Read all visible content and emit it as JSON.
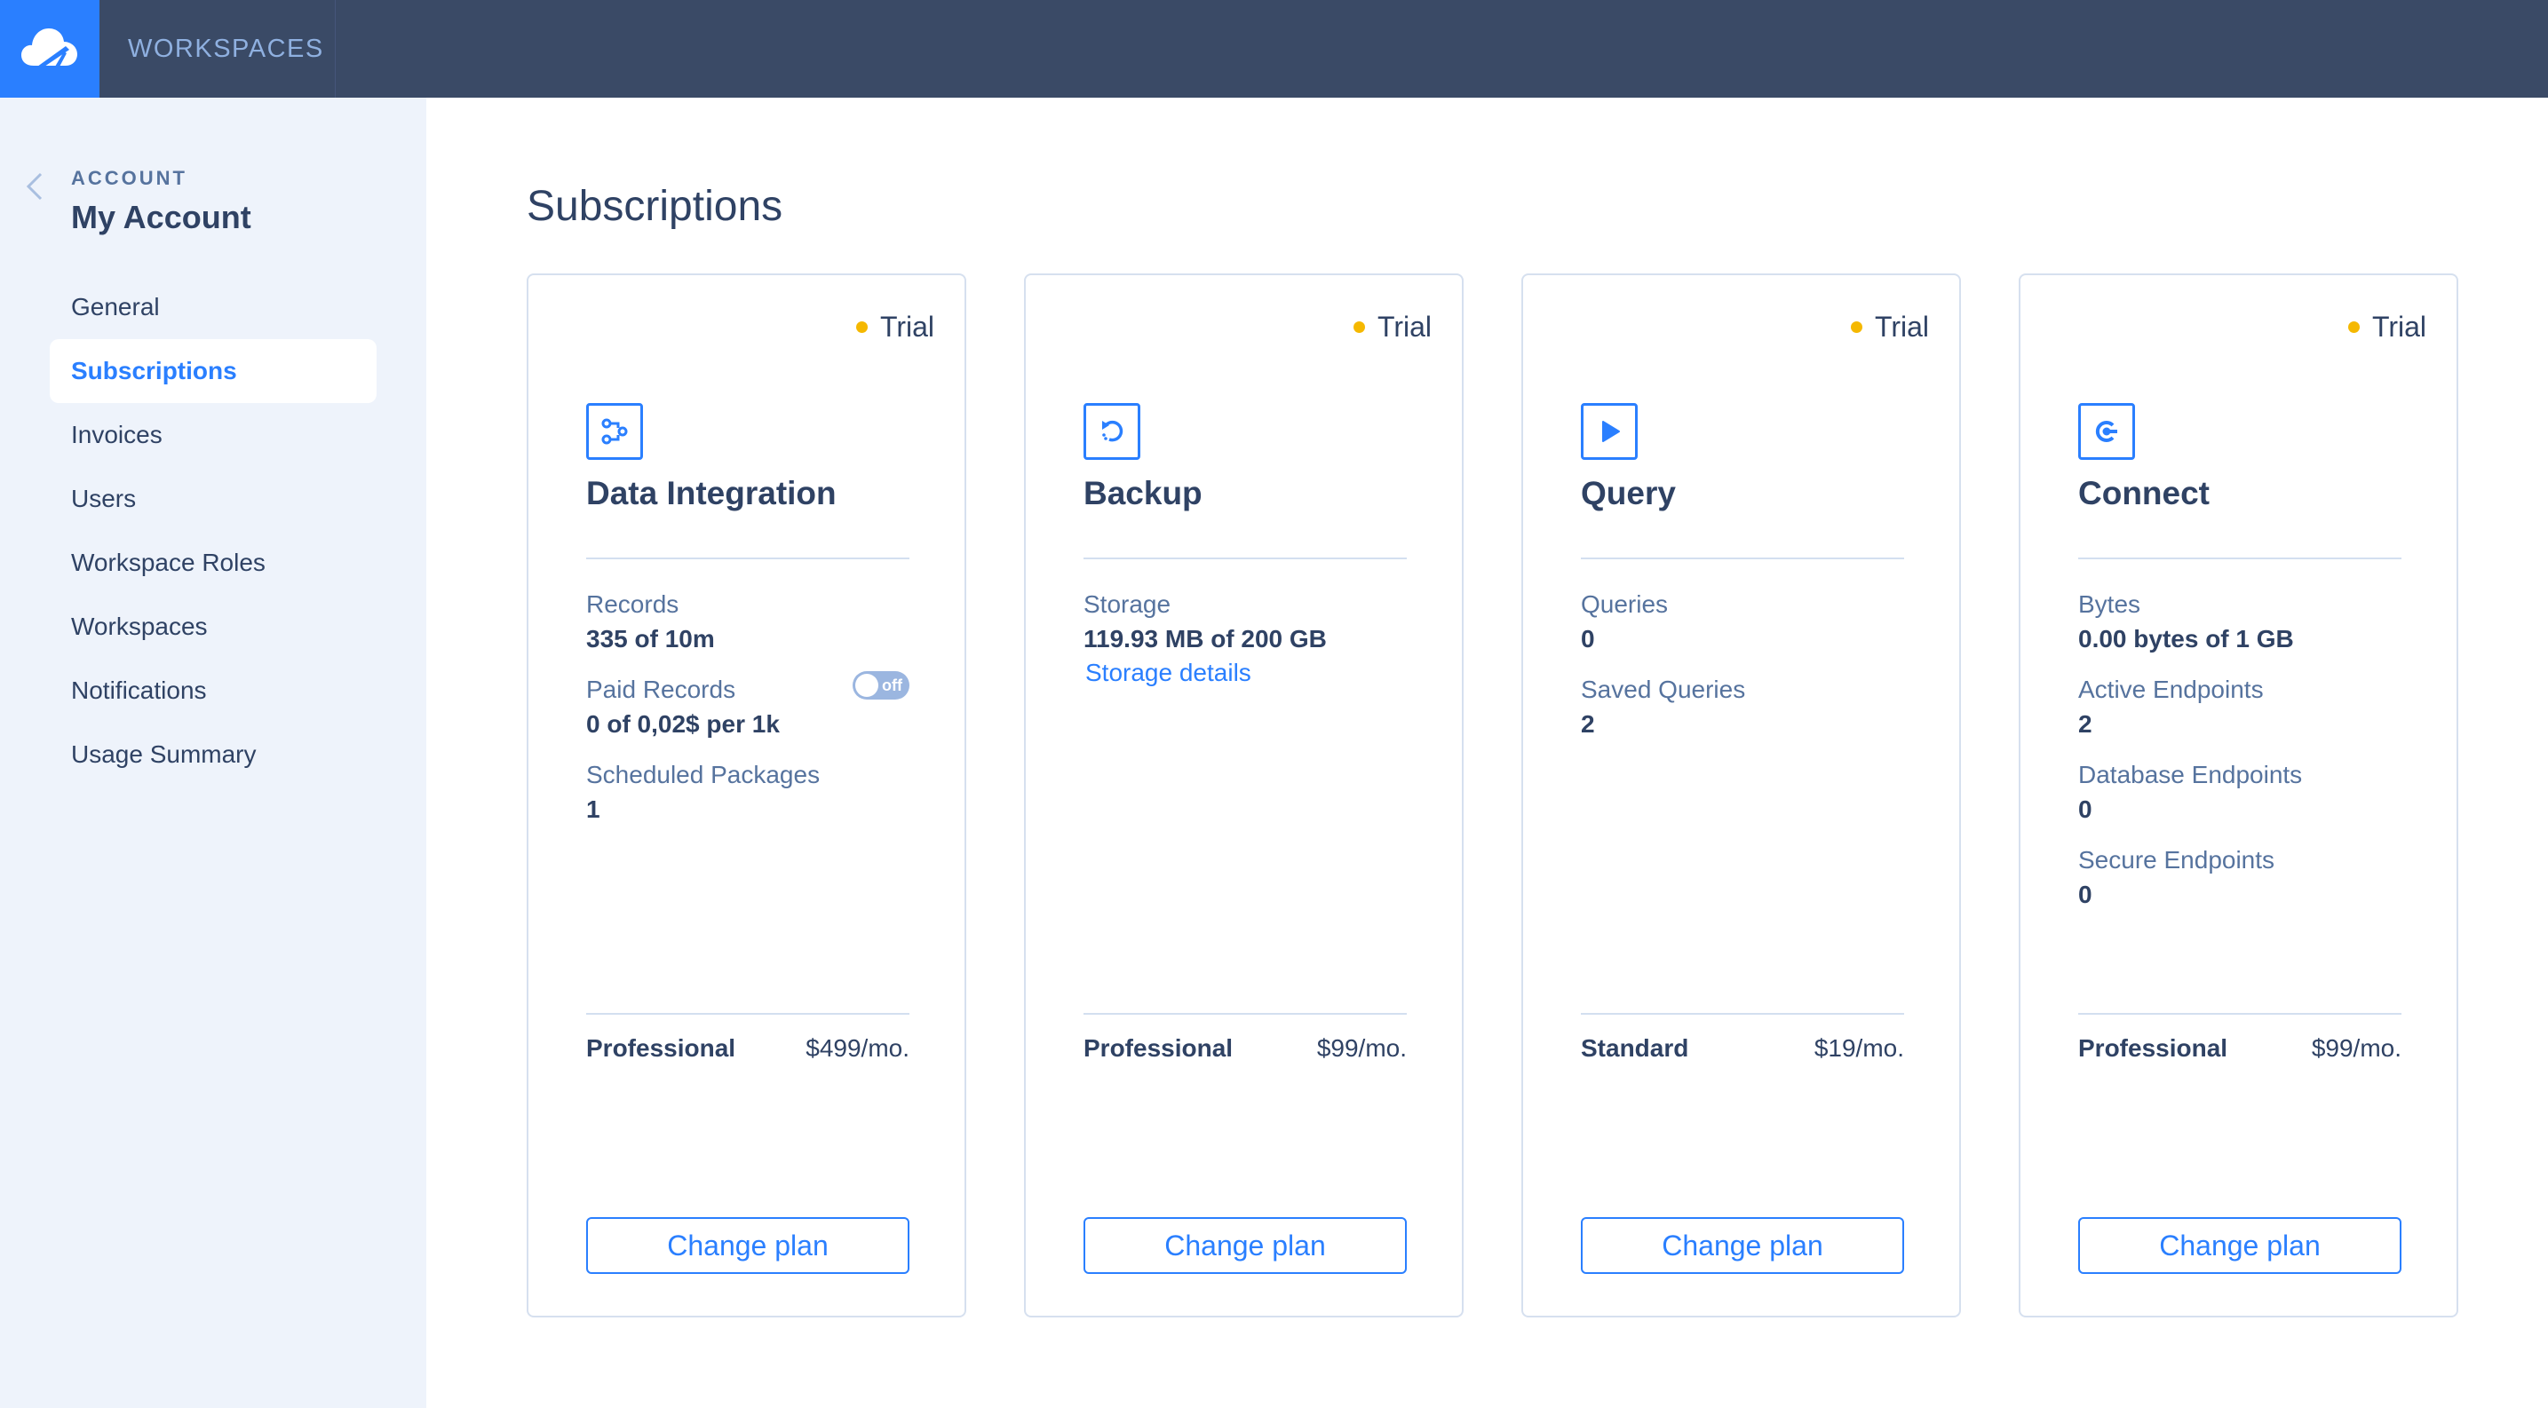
{
  "topbar": {
    "logo_icon": "cloud-logo-icon",
    "tab_label": "WORKSPACES",
    "colors": {
      "bar": "#3a4a66",
      "logo_bg": "#2a7fff"
    }
  },
  "sidebar": {
    "back_icon": "chevron-left-icon",
    "section_label": "ACCOUNT",
    "title": "My Account",
    "items": [
      {
        "label": "General",
        "active": false
      },
      {
        "label": "Subscriptions",
        "active": true
      },
      {
        "label": "Invoices",
        "active": false
      },
      {
        "label": "Users",
        "active": false
      },
      {
        "label": "Workspace Roles",
        "active": false
      },
      {
        "label": "Workspaces",
        "active": false
      },
      {
        "label": "Notifications",
        "active": false
      },
      {
        "label": "Usage Summary",
        "active": false
      }
    ]
  },
  "main": {
    "title": "Subscriptions",
    "cards": [
      {
        "status": "Trial",
        "icon": "data-integration-icon",
        "title": "Data Integration",
        "metrics": [
          {
            "label": "Records",
            "value": "335 of 10m"
          },
          {
            "label": "Paid Records",
            "value": "0 of 0,02$ per 1k",
            "toggle": "off"
          },
          {
            "label": "Scheduled Packages",
            "value": "1"
          }
        ],
        "plan": "Professional",
        "price": "$499/mo.",
        "button": "Change plan"
      },
      {
        "status": "Trial",
        "icon": "backup-restore-icon",
        "title": "Backup",
        "metrics": [
          {
            "label": "Storage",
            "value": "119.93 MB of 200 GB",
            "link": "Storage details"
          }
        ],
        "plan": "Professional",
        "price": "$99/mo.",
        "button": "Change plan"
      },
      {
        "status": "Trial",
        "icon": "play-icon",
        "title": "Query",
        "metrics": [
          {
            "label": "Queries",
            "value": "0"
          },
          {
            "label": "Saved Queries",
            "value": "2"
          }
        ],
        "plan": "Standard",
        "price": "$19/mo.",
        "button": "Change plan"
      },
      {
        "status": "Trial",
        "icon": "connect-icon",
        "title": "Connect",
        "metrics": [
          {
            "label": "Bytes",
            "value": "0.00 bytes of 1 GB"
          },
          {
            "label": "Active Endpoints",
            "value": "2"
          },
          {
            "label": "Database Endpoints",
            "value": "0"
          },
          {
            "label": "Secure Endpoints",
            "value": "0"
          }
        ],
        "plan": "Professional",
        "price": "$99/mo.",
        "button": "Change plan"
      }
    ]
  },
  "colors": {
    "accent": "#2a7fff",
    "trial_dot": "#f5b800",
    "text_dark": "#2f4264",
    "text_muted": "#56739e",
    "sidebar_bg": "#eef3fb"
  }
}
